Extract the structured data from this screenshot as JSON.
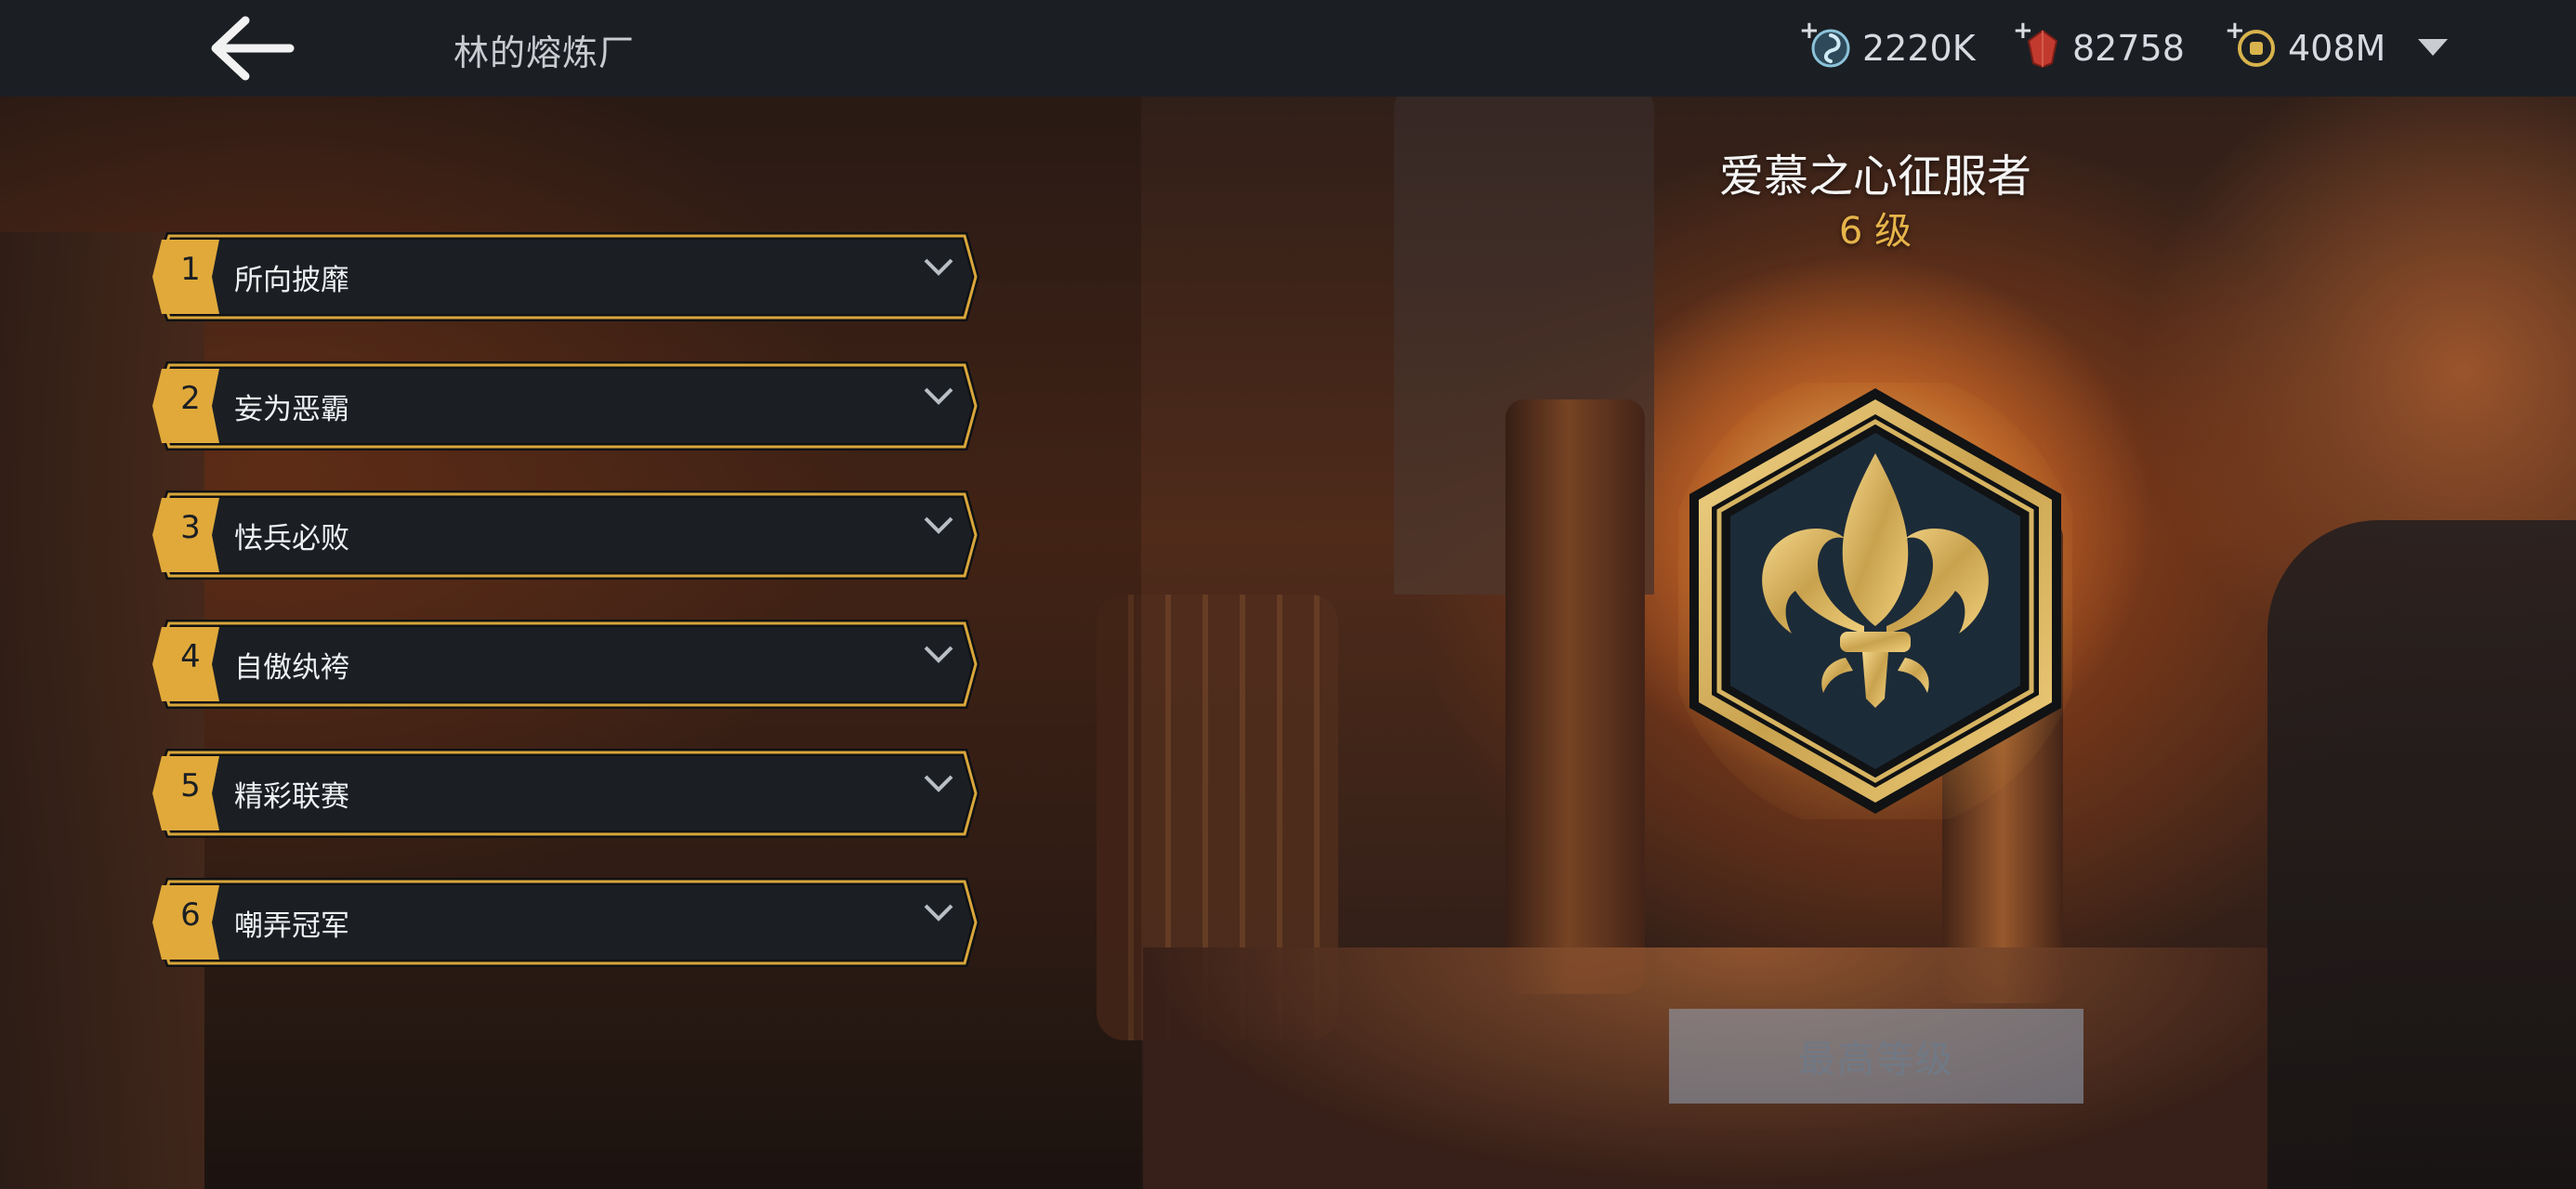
{
  "header": {
    "title": "林的熔炼厂",
    "back_icon": "arrow-left-icon",
    "resources": [
      {
        "icon": "swirl-currency-icon",
        "value": "2220K",
        "color": "#7fb2c9"
      },
      {
        "icon": "red-gem-icon",
        "value": "82758",
        "color": "#c0392b"
      },
      {
        "icon": "gold-coin-icon",
        "value": "408M",
        "color": "#d4b04a"
      }
    ],
    "expand_icon": "triangle-down-icon"
  },
  "list": {
    "items": [
      {
        "number": "1",
        "label": "所向披靡"
      },
      {
        "number": "2",
        "label": "妄为恶霸"
      },
      {
        "number": "3",
        "label": "怯兵必败"
      },
      {
        "number": "4",
        "label": "自傲纨袴"
      },
      {
        "number": "5",
        "label": "精彩联赛"
      },
      {
        "number": "6",
        "label": "嘲弄冠军"
      }
    ]
  },
  "detail": {
    "title": "爱慕之心征服者",
    "level": "6 级",
    "emblem_icon": "fleur-de-lis-hexagon-badge-icon",
    "button_label": "最高等级"
  },
  "colors": {
    "accent_gold": "#e0a93a",
    "topbar_bg": "#1b1f24",
    "item_bg": "#1b1f24"
  }
}
